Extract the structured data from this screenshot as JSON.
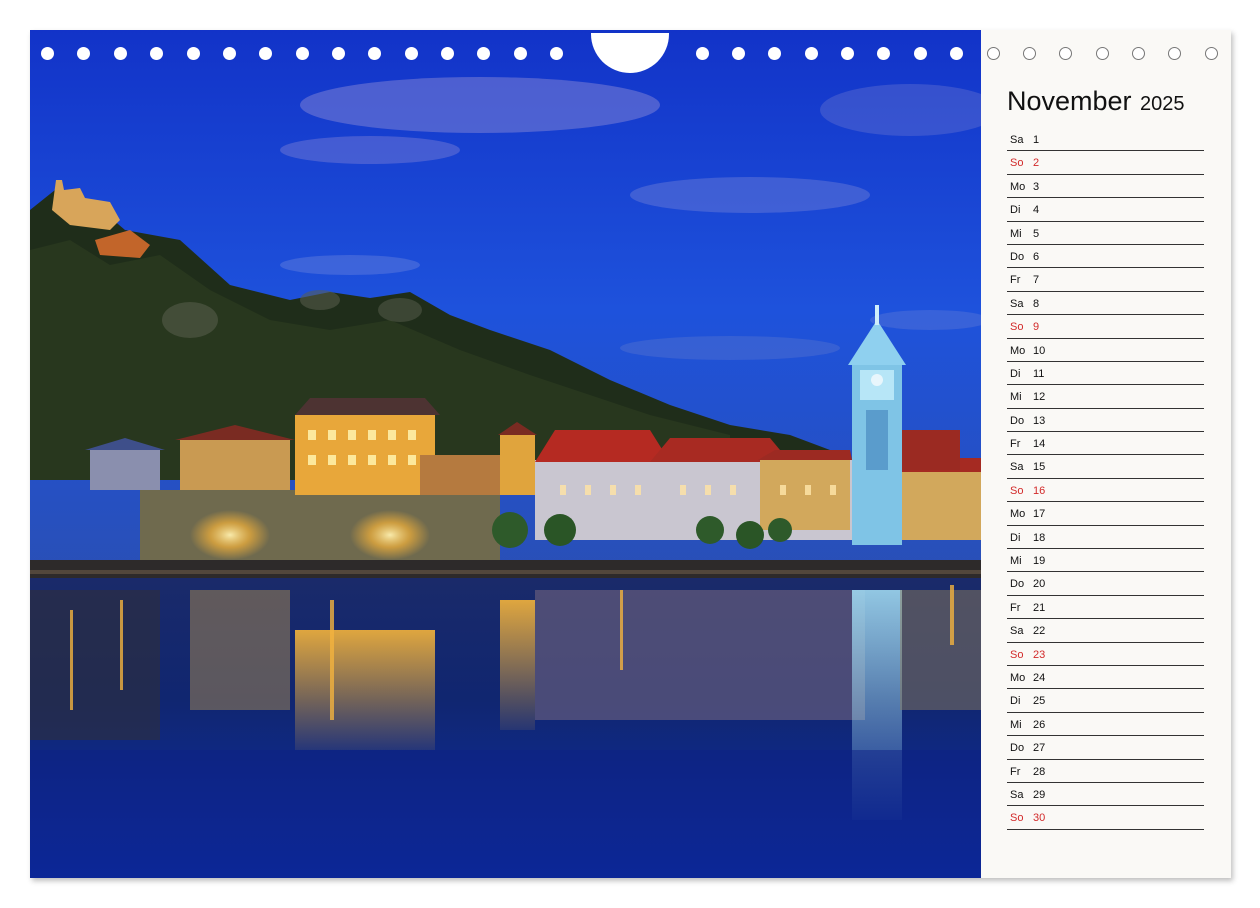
{
  "calendar": {
    "month": "November",
    "year": "2025",
    "days": [
      {
        "weekday": "Sa",
        "day": "1",
        "sunday": false
      },
      {
        "weekday": "So",
        "day": "2",
        "sunday": true
      },
      {
        "weekday": "Mo",
        "day": "3",
        "sunday": false
      },
      {
        "weekday": "Di",
        "day": "4",
        "sunday": false
      },
      {
        "weekday": "Mi",
        "day": "5",
        "sunday": false
      },
      {
        "weekday": "Do",
        "day": "6",
        "sunday": false
      },
      {
        "weekday": "Fr",
        "day": "7",
        "sunday": false
      },
      {
        "weekday": "Sa",
        "day": "8",
        "sunday": false
      },
      {
        "weekday": "So",
        "day": "9",
        "sunday": true
      },
      {
        "weekday": "Mo",
        "day": "10",
        "sunday": false
      },
      {
        "weekday": "Di",
        "day": "11",
        "sunday": false
      },
      {
        "weekday": "Mi",
        "day": "12",
        "sunday": false
      },
      {
        "weekday": "Do",
        "day": "13",
        "sunday": false
      },
      {
        "weekday": "Fr",
        "day": "14",
        "sunday": false
      },
      {
        "weekday": "Sa",
        "day": "15",
        "sunday": false
      },
      {
        "weekday": "So",
        "day": "16",
        "sunday": true
      },
      {
        "weekday": "Mo",
        "day": "17",
        "sunday": false
      },
      {
        "weekday": "Di",
        "day": "18",
        "sunday": false
      },
      {
        "weekday": "Mi",
        "day": "19",
        "sunday": false
      },
      {
        "weekday": "Do",
        "day": "20",
        "sunday": false
      },
      {
        "weekday": "Fr",
        "day": "21",
        "sunday": false
      },
      {
        "weekday": "Sa",
        "day": "22",
        "sunday": false
      },
      {
        "weekday": "So",
        "day": "23",
        "sunday": true
      },
      {
        "weekday": "Mo",
        "day": "24",
        "sunday": false
      },
      {
        "weekday": "Di",
        "day": "25",
        "sunday": false
      },
      {
        "weekday": "Mi",
        "day": "26",
        "sunday": false
      },
      {
        "weekday": "Do",
        "day": "27",
        "sunday": false
      },
      {
        "weekday": "Fr",
        "day": "28",
        "sunday": false
      },
      {
        "weekday": "Sa",
        "day": "29",
        "sunday": false
      },
      {
        "weekday": "So",
        "day": "30",
        "sunday": true
      }
    ]
  },
  "colors": {
    "sunday_text": "#d22a2a",
    "weekday_text": "#111111",
    "sidebar_background": "#faf9f6",
    "sky_blue": "#1f4fd6",
    "night_water": "#0f2a9c",
    "light_gold": "#f6b73c"
  },
  "icons": {
    "binding": "spiral-binding-holes",
    "hanger": "wall-hanger-notch"
  }
}
